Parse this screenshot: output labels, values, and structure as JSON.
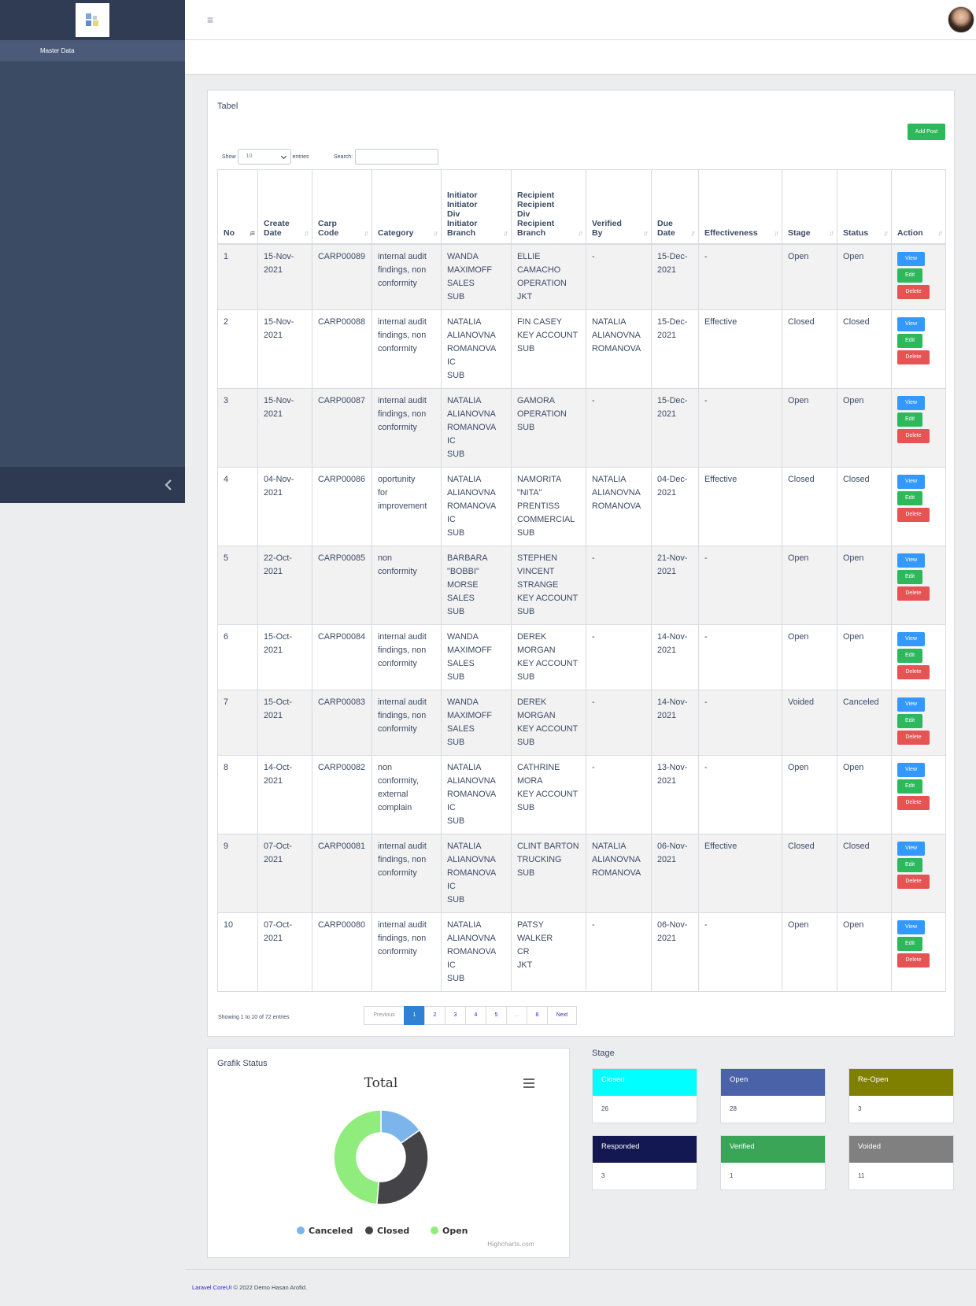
{
  "sidebar": {
    "nav_items": [
      {
        "label": "Master Data"
      }
    ],
    "logo_icon": "app-logo-icon",
    "toggle_icon": "chevron-left-icon"
  },
  "header": {
    "menu_icon": "hamburger-icon",
    "avatar": "user-avatar"
  },
  "tabel": {
    "title": "Tabel",
    "add_button": "Add Post",
    "length": {
      "prefix": "Show",
      "value": "10",
      "suffix": "entries"
    },
    "search": {
      "label": "Search:",
      "value": ""
    },
    "columns": [
      "No",
      "Create Date",
      "Carp Code",
      "Category",
      "Initiator Initiator Div Initiator Branch",
      "Recipient Recipient Div Recipient Branch",
      "Verified By",
      "Due Date",
      "Effectiveness",
      "Stage",
      "Status",
      "Action"
    ],
    "column_display": [
      "No",
      "Create\nDate",
      "Carp\nCode",
      "Category",
      "Initiator\nInitiator\nDiv\nInitiator\nBranch",
      "Recipient\nRecipient\nDiv\nRecipient\nBranch",
      "Verified\nBy",
      "Due\nDate",
      "Effectiveness",
      "Stage",
      "Status",
      "Action"
    ],
    "rows": [
      {
        "no": "1",
        "create": "15-Nov-\n2021",
        "code": "CARP00089",
        "category": "internal audit\nfindings, non\nconformity",
        "initiator": "WANDA\nMAXIMOFF\nSALES\nSUB",
        "recipient": "ELLIE\nCAMACHO\nOPERATION\nJKT",
        "verified": "-",
        "due": "15-Dec-\n2021",
        "eff": "-",
        "stage": "Open",
        "status": "Open"
      },
      {
        "no": "2",
        "create": "15-Nov-\n2021",
        "code": "CARP00088",
        "category": "internal audit\nfindings, non\nconformity",
        "initiator": "NATALIA\nALIANOVNA\nROMANOVA\nIC\nSUB",
        "recipient": "FIN CASEY\nKEY ACCOUNT\nSUB",
        "verified": "NATALIA\nALIANOVNA\nROMANOVA",
        "due": "15-Dec-\n2021",
        "eff": "Effective",
        "stage": "Closed",
        "status": "Closed"
      },
      {
        "no": "3",
        "create": "15-Nov-\n2021",
        "code": "CARP00087",
        "category": "internal audit\nfindings, non\nconformity",
        "initiator": "NATALIA\nALIANOVNA\nROMANOVA\nIC\nSUB",
        "recipient": "GAMORA\nOPERATION\nSUB",
        "verified": "-",
        "due": "15-Dec-\n2021",
        "eff": "-",
        "stage": "Open",
        "status": "Open"
      },
      {
        "no": "4",
        "create": "04-Nov-\n2021",
        "code": "CARP00086",
        "category": "oportunity\nfor\nimprovement",
        "initiator": "NATALIA\nALIANOVNA\nROMANOVA\nIC\nSUB",
        "recipient": "NAMORITA\n\"NITA\"\nPRENTISS\nCOMMERCIAL\nSUB",
        "verified": "NATALIA\nALIANOVNA\nROMANOVA",
        "due": "04-Dec-\n2021",
        "eff": "Effective",
        "stage": "Closed",
        "status": "Closed"
      },
      {
        "no": "5",
        "create": "22-Oct-\n2021",
        "code": "CARP00085",
        "category": "non\nconformity",
        "initiator": "BARBARA\n\"BOBBI\"\nMORSE\nSALES\nSUB",
        "recipient": "STEPHEN\nVINCENT\nSTRANGE\nKEY ACCOUNT\nSUB",
        "verified": "-",
        "due": "21-Nov-\n2021",
        "eff": "-",
        "stage": "Open",
        "status": "Open"
      },
      {
        "no": "6",
        "create": "15-Oct-\n2021",
        "code": "CARP00084",
        "category": "internal audit\nfindings, non\nconformity",
        "initiator": "WANDA\nMAXIMOFF\nSALES\nSUB",
        "recipient": "DEREK\nMORGAN\nKEY ACCOUNT\nSUB",
        "verified": "-",
        "due": "14-Nov-\n2021",
        "eff": "-",
        "stage": "Open",
        "status": "Open"
      },
      {
        "no": "7",
        "create": "15-Oct-\n2021",
        "code": "CARP00083",
        "category": "internal audit\nfindings, non\nconformity",
        "initiator": "WANDA\nMAXIMOFF\nSALES\nSUB",
        "recipient": "DEREK\nMORGAN\nKEY ACCOUNT\nSUB",
        "verified": "-",
        "due": "14-Nov-\n2021",
        "eff": "-",
        "stage": "Voided",
        "status": "Canceled"
      },
      {
        "no": "8",
        "create": "14-Oct-\n2021",
        "code": "CARP00082",
        "category": "non\nconformity,\nexternal\ncomplain",
        "initiator": "NATALIA\nALIANOVNA\nROMANOVA\nIC\nSUB",
        "recipient": "CATHRINE\nMORA\nKEY ACCOUNT\nSUB",
        "verified": "-",
        "due": "13-Nov-\n2021",
        "eff": "-",
        "stage": "Open",
        "status": "Open"
      },
      {
        "no": "9",
        "create": "07-Oct-\n2021",
        "code": "CARP00081",
        "category": "internal audit\nfindings, non\nconformity",
        "initiator": "NATALIA\nALIANOVNA\nROMANOVA\nIC\nSUB",
        "recipient": "CLINT BARTON\nTRUCKING\nSUB",
        "verified": "NATALIA\nALIANOVNA\nROMANOVA",
        "due": "06-Nov-\n2021",
        "eff": "Effective",
        "stage": "Closed",
        "status": "Closed"
      },
      {
        "no": "10",
        "create": "07-Oct-\n2021",
        "code": "CARP00080",
        "category": "internal audit\nfindings, non\nconformity",
        "initiator": "NATALIA\nALIANOVNA\nROMANOVA\nIC\nSUB",
        "recipient": "PATSY WALKER\nCR\nJKT",
        "verified": "-",
        "due": "06-Nov-\n2021",
        "eff": "-",
        "stage": "Open",
        "status": "Open"
      }
    ],
    "actions": {
      "view": "View",
      "edit": "Edit",
      "delete": "Delete"
    },
    "info": "Showing 1 to 10 of 72 entries",
    "pagination": [
      "Previous",
      "1",
      "2",
      "3",
      "4",
      "5",
      "…",
      "8",
      "Next"
    ],
    "current_page": "1"
  },
  "grafik": {
    "card_title": "Grafik Status",
    "credit": "Highcharts.com",
    "menu_icon": "chart-menu-icon",
    "chart_data": {
      "type": "pie",
      "title": "Total",
      "labels": [
        "Canceled",
        "Closed",
        "Open"
      ],
      "values": [
        11,
        26,
        35
      ],
      "colors": [
        "#7cb5ec",
        "#434348",
        "#90ed7d"
      ],
      "legend": "bottom-center"
    }
  },
  "stage": {
    "title": "Stage",
    "boxes": [
      {
        "label": "Closed",
        "value": "26",
        "color": "#00ffff",
        "text_color": "#ffffff"
      },
      {
        "label": "Open",
        "value": "28",
        "color": "#4a63a8",
        "text_color": "#ffffff"
      },
      {
        "label": "Re-Open",
        "value": "3",
        "color": "#808000",
        "text_color": "#ffffff"
      },
      {
        "label": "Responded",
        "value": "3",
        "color": "#141852",
        "text_color": "#ffffff"
      },
      {
        "label": "Verified",
        "value": "1",
        "color": "#3aa557",
        "text_color": "#ffffff"
      },
      {
        "label": "Voided",
        "value": "11",
        "color": "#808080",
        "text_color": "#ffffff"
      }
    ]
  },
  "footer": {
    "link": "Laravel CoreUI",
    "text": "© 2022 Demo Hasan Arofid."
  }
}
